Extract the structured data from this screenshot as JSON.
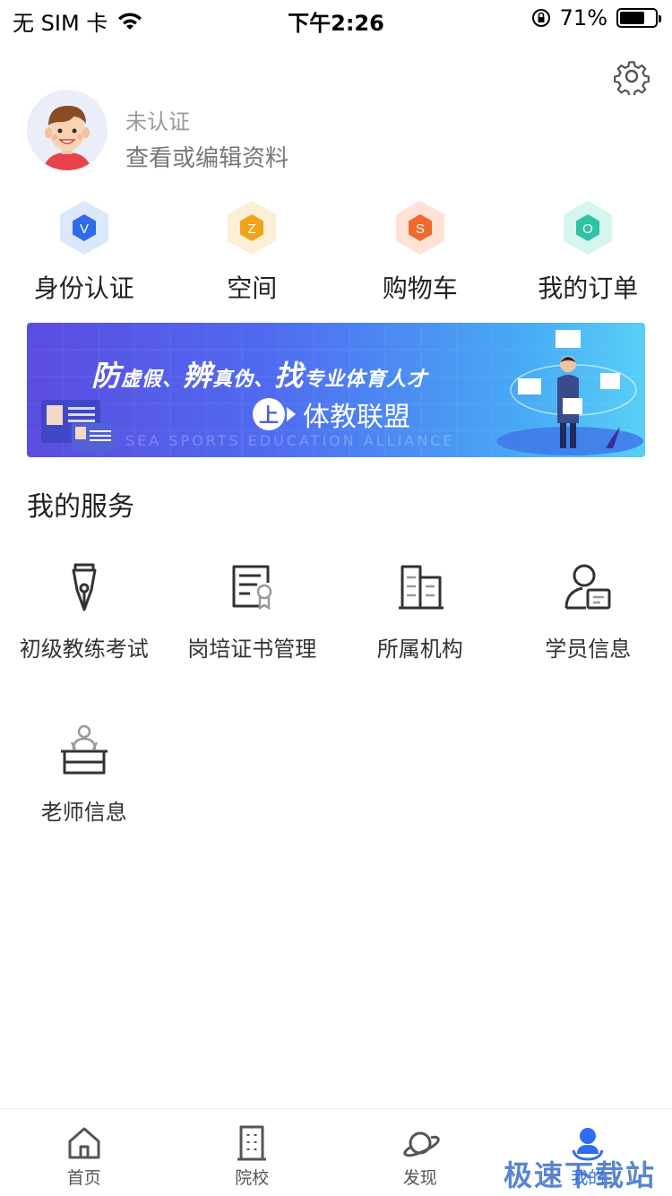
{
  "status_bar": {
    "carrier": "无 SIM 卡",
    "time": "下午2:26",
    "battery_text": "71%",
    "battery_level": 0.71
  },
  "profile": {
    "status": "未认证",
    "edit_link": "查看或编辑资料"
  },
  "quick_actions": [
    {
      "letter": "V",
      "label": "身份认证",
      "color": "#2e6ce8",
      "bg": "#dbe7fb"
    },
    {
      "letter": "Z",
      "label": "空间",
      "color": "#f3a21c",
      "bg": "#fdefd6"
    },
    {
      "letter": "S",
      "label": "购物车",
      "color": "#f06a2c",
      "bg": "#fde2d5"
    },
    {
      "letter": "O",
      "label": "我的订单",
      "color": "#2fc3a6",
      "bg": "#d6f5ef"
    }
  ],
  "banner": {
    "h1": "防",
    "h1_sm": "虚假、",
    "h2": "辨",
    "h2_sm": "真伪、",
    "h3": "找",
    "h3_sm": "专业体育人才",
    "brand_badge": "上",
    "brand": "体教联盟",
    "watermark": "SEA  SPORTS EDUCATION ALLIANCE"
  },
  "services": {
    "title": "我的服务",
    "items": [
      {
        "label": "初级教练考试",
        "icon": "pen-nib-icon"
      },
      {
        "label": "岗培证书管理",
        "icon": "certificate-icon"
      },
      {
        "label": "所属机构",
        "icon": "building-icon"
      },
      {
        "label": "学员信息",
        "icon": "student-card-icon"
      },
      {
        "label": "老师信息",
        "icon": "teacher-desk-icon"
      }
    ]
  },
  "tabbar": {
    "items": [
      {
        "label": "首页",
        "icon": "home-icon",
        "active": false
      },
      {
        "label": "院校",
        "icon": "school-icon",
        "active": false
      },
      {
        "label": "发现",
        "icon": "planet-icon",
        "active": false
      },
      {
        "label": "我的",
        "icon": "profile-icon",
        "active": true
      }
    ]
  },
  "overlay_watermark": "极速下载站"
}
